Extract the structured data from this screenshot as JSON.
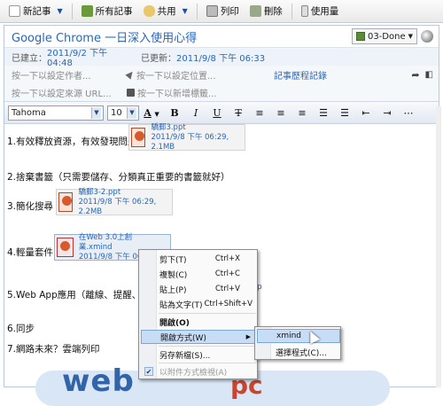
{
  "toolbar": {
    "new_note": "新記事",
    "all_notes": "所有記事",
    "share": "共用",
    "print": "列印",
    "delete": "刪除",
    "usage": "使用量"
  },
  "note": {
    "title": "Google Chrome 一日深入使用心得",
    "notebook": "03-Done",
    "created_label": "已建立：",
    "created": "2011/9/2 下午 04:48",
    "updated_label": "已更新：",
    "updated": "2011/9/8 下午 06:33",
    "author_hint": "按一下以設定作者...",
    "location_hint": "按一下以設定位置...",
    "history_link": "記事歷程記錄",
    "source_hint": "按一下以設定來源 URL...",
    "tag_hint": "按一下以新增標籤..."
  },
  "format": {
    "font": "Tahoma",
    "size": "10"
  },
  "content": {
    "line1": "1.有效釋放資源，有效發現問題",
    "att1_name": "驕郵3.ppt",
    "att1_info": "2011/9/8 下午 06:29, 2.1MB",
    "line2": "2.捨棄書籤（只需要儲存、分類真正重要的書籤就好）",
    "line3": "3.簡化搜尋",
    "att2_name": "驕郵3-2.ppt",
    "att2_info": "2011/9/8 下午 06:29, 2.2MB",
    "line4": "4.輕量套件",
    "att3_name": "在Web 3.0上創業.xmind",
    "att3_info": "2011/9/8 下午 06:30",
    "line5": "5.Web App應用（離線、提醒、連...",
    "att4_frag": "p",
    "line6": "6.同步",
    "line7": "7.網路未來？雲端列印",
    "art1": "web",
    "art2": "pc"
  },
  "menu": {
    "cut": "剪下(T)",
    "cut_sc": "Ctrl+X",
    "copy": "複製(C)",
    "copy_sc": "Ctrl+C",
    "paste": "貼上(P)",
    "paste_sc": "Ctrl+V",
    "paste_text": "貼為文字(T)",
    "paste_text_sc": "Ctrl+Shift+V",
    "open": "開啟(O)",
    "open_with": "開啟方式(W)",
    "save_as": "另存新檔(S)...",
    "view_as_attachment": "以附件方式檢視(A)"
  },
  "submenu": {
    "xmind": "xmind",
    "choose": "選擇程式(C)..."
  }
}
